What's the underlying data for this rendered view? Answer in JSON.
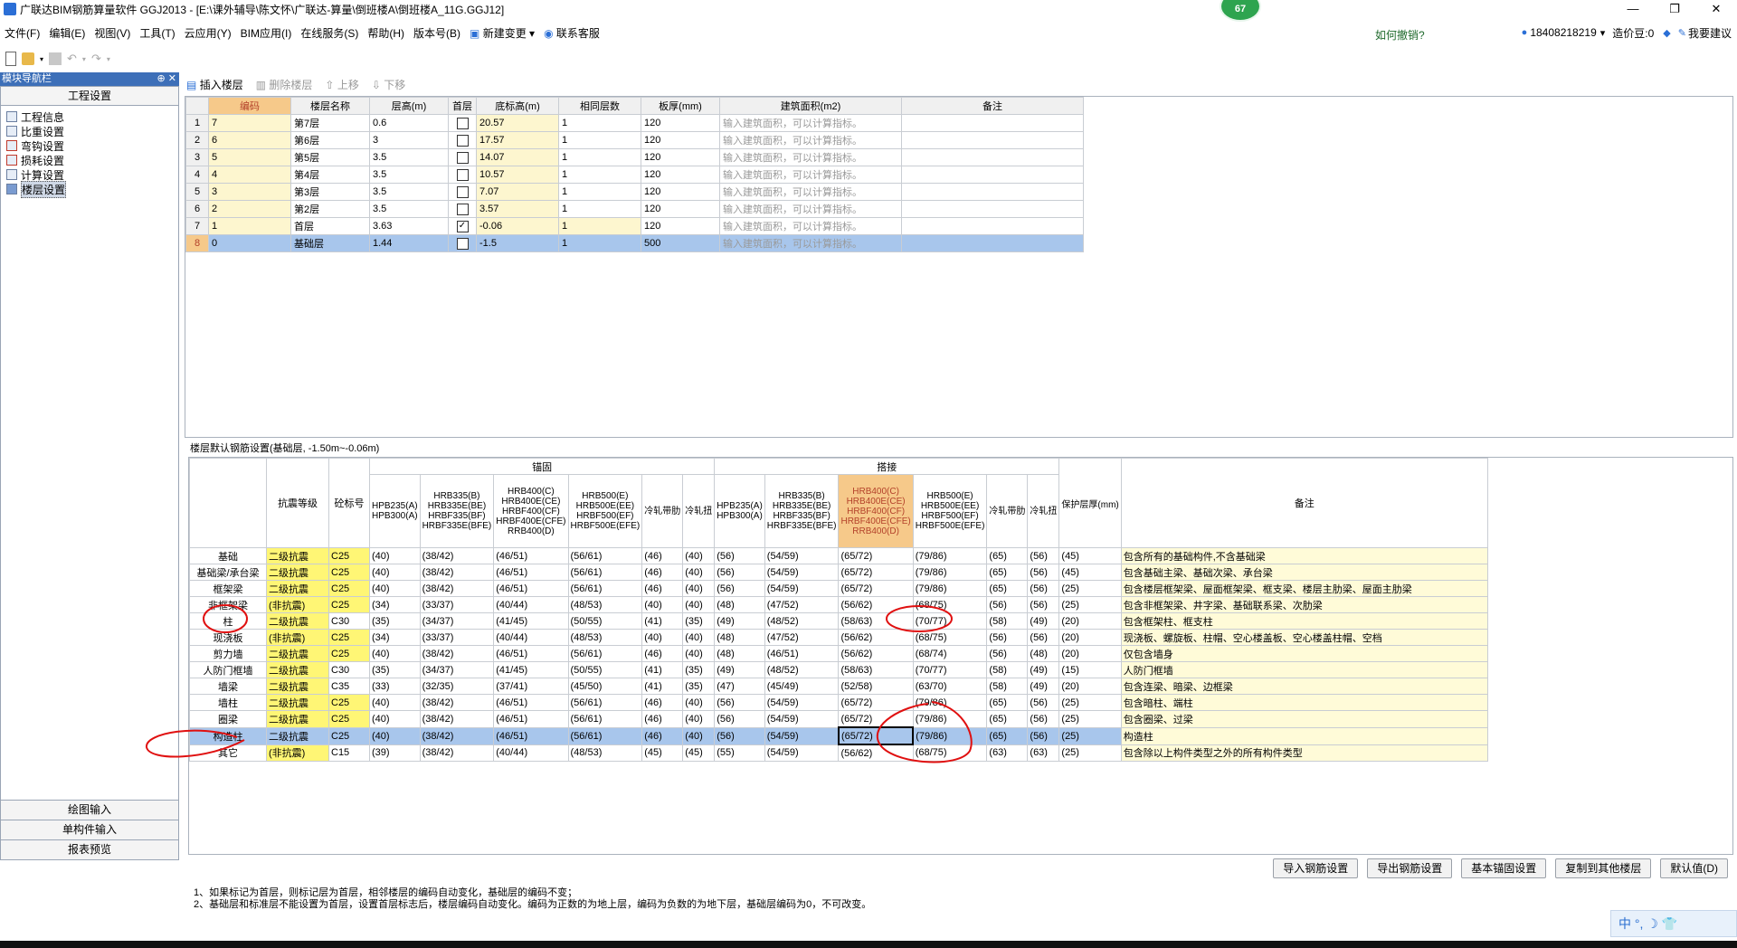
{
  "window": {
    "title": "广联达BIM钢筋算量软件 GGJ2013 - [E:\\课外辅导\\陈文怀\\广联达-算量\\倒班楼A\\倒班楼A_11G.GGJ12]",
    "badge": "67",
    "controls": [
      "—",
      "❐",
      "✕"
    ]
  },
  "menu": {
    "items": [
      "文件(F)",
      "编辑(E)",
      "视图(V)",
      "工具(T)",
      "云应用(Y)",
      "BIM应用(I)",
      "在线服务(S)",
      "帮助(H)",
      "版本号(B)",
      "新建变更",
      "联系客服"
    ],
    "help_text": "如何撤销?",
    "account": "18408218219",
    "beans": "造价豆:0",
    "want_help": "我要建议"
  },
  "nav": {
    "header": "模块导航栏",
    "pins": "⊕ ✕",
    "title": "工程设置",
    "items": [
      {
        "label": "工程信息",
        "icon": "info-icon"
      },
      {
        "label": "比重设置",
        "icon": "weight-icon"
      },
      {
        "label": "弯钩设置",
        "icon": "hook-icon"
      },
      {
        "label": "损耗设置",
        "icon": "loss-icon"
      },
      {
        "label": "计算设置",
        "icon": "calc-icon"
      },
      {
        "label": "楼层设置",
        "icon": "floor-icon"
      }
    ],
    "bottom": [
      "绘图输入",
      "单构件输入",
      "报表预览"
    ]
  },
  "floor_toolbar": {
    "insert": "插入楼层",
    "delete": "删除楼层",
    "up": "上移",
    "down": "下移"
  },
  "floor_table": {
    "headers": [
      "编码",
      "楼层名称",
      "层高(m)",
      "首层",
      "底标高(m)",
      "相同层数",
      "板厚(mm)",
      "建筑面积(m2)",
      "备注"
    ],
    "placeholder": "输入建筑面积，可以计算指标。",
    "rows": [
      {
        "n": "1",
        "code": "7",
        "name": "第7层",
        "h": "0.6",
        "first": false,
        "base": "20.57",
        "same": "1",
        "thick": "120"
      },
      {
        "n": "2",
        "code": "6",
        "name": "第6层",
        "h": "3",
        "first": false,
        "base": "17.57",
        "same": "1",
        "thick": "120"
      },
      {
        "n": "3",
        "code": "5",
        "name": "第5层",
        "h": "3.5",
        "first": false,
        "base": "14.07",
        "same": "1",
        "thick": "120"
      },
      {
        "n": "4",
        "code": "4",
        "name": "第4层",
        "h": "3.5",
        "first": false,
        "base": "10.57",
        "same": "1",
        "thick": "120"
      },
      {
        "n": "5",
        "code": "3",
        "name": "第3层",
        "h": "3.5",
        "first": false,
        "base": "7.07",
        "same": "1",
        "thick": "120"
      },
      {
        "n": "6",
        "code": "2",
        "name": "第2层",
        "h": "3.5",
        "first": false,
        "base": "3.57",
        "same": "1",
        "thick": "120"
      },
      {
        "n": "7",
        "code": "1",
        "name": "首层",
        "h": "3.63",
        "first": true,
        "base": "-0.06",
        "same": "1",
        "thick": "120"
      },
      {
        "n": "8",
        "code": "0",
        "name": "基础层",
        "h": "1.44",
        "first": false,
        "base": "-1.5",
        "same": "1",
        "thick": "500"
      }
    ]
  },
  "rebar": {
    "caption": "楼层默认钢筋设置(基础层, -1.50m~-0.06m)",
    "group_anchor": "锚固",
    "group_lap": "搭接",
    "h_grade": "抗震等级",
    "h_conc": "砼标号",
    "h_cover": "保护层厚(mm)",
    "h_note": "备注",
    "sub_headers": [
      "HPB235(A)\nHPB300(A)",
      "HRB335(B)\nHRB335E(BE)\nHRBF335(BF)\nHRBF335E(BFE)",
      "HRB400(C)\nHRB400E(CE)\nHRBF400(CF)\nHRBF400E(CFE)\nRRB400(D)",
      "HRB500(E)\nHRB500E(EE)\nHRBF500(EF)\nHRBF500E(EFE)",
      "冷轧带肋",
      "冷轧扭"
    ],
    "rows": [
      {
        "name": "基础",
        "grade": "二级抗震",
        "conc": "C25",
        "a": [
          "(40)",
          "(38/42)",
          "(46/51)",
          "(56/61)",
          "(46)",
          "(40)"
        ],
        "l": [
          "(56)",
          "(54/59)",
          "(65/72)",
          "(79/86)",
          "(65)",
          "(56)"
        ],
        "cover": "(45)",
        "note": "包含所有的基础构件,不含基础梁"
      },
      {
        "name": "基础梁/承台梁",
        "grade": "二级抗震",
        "conc": "C25",
        "a": [
          "(40)",
          "(38/42)",
          "(46/51)",
          "(56/61)",
          "(46)",
          "(40)"
        ],
        "l": [
          "(56)",
          "(54/59)",
          "(65/72)",
          "(79/86)",
          "(65)",
          "(56)"
        ],
        "cover": "(45)",
        "note": "包含基础主梁、基础次梁、承台梁"
      },
      {
        "name": "框架梁",
        "grade": "二级抗震",
        "conc": "C25",
        "a": [
          "(40)",
          "(38/42)",
          "(46/51)",
          "(56/61)",
          "(46)",
          "(40)"
        ],
        "l": [
          "(56)",
          "(54/59)",
          "(65/72)",
          "(79/86)",
          "(65)",
          "(56)"
        ],
        "cover": "(25)",
        "note": "包含楼层框架梁、屋面框架梁、框支梁、楼层主肋梁、屋面主肋梁"
      },
      {
        "name": "非框架梁",
        "grade": "(非抗震)",
        "conc": "C25",
        "a": [
          "(34)",
          "(33/37)",
          "(40/44)",
          "(48/53)",
          "(40)",
          "(40)"
        ],
        "l": [
          "(48)",
          "(47/52)",
          "(56/62)",
          "(68/75)",
          "(56)",
          "(56)"
        ],
        "cover": "(25)",
        "note": "包含非框架梁、井字梁、基础联系梁、次肋梁"
      },
      {
        "name": "柱",
        "grade": "二级抗震",
        "conc": "C30",
        "a": [
          "(35)",
          "(34/37)",
          "(41/45)",
          "(50/55)",
          "(41)",
          "(35)"
        ],
        "l": [
          "(49)",
          "(48/52)",
          "(58/63)",
          "(70/77)",
          "(58)",
          "(49)"
        ],
        "cover": "(20)",
        "note": "包含框架柱、框支柱"
      },
      {
        "name": "现浇板",
        "grade": "(非抗震)",
        "conc": "C25",
        "a": [
          "(34)",
          "(33/37)",
          "(40/44)",
          "(48/53)",
          "(40)",
          "(40)"
        ],
        "l": [
          "(48)",
          "(47/52)",
          "(56/62)",
          "(68/75)",
          "(56)",
          "(56)"
        ],
        "cover": "(20)",
        "note": "现浇板、螺旋板、柱帽、空心楼盖板、空心楼盖柱帽、空档"
      },
      {
        "name": "剪力墙",
        "grade": "二级抗震",
        "conc": "C25",
        "a": [
          "(40)",
          "(38/42)",
          "(46/51)",
          "(56/61)",
          "(46)",
          "(40)"
        ],
        "l": [
          "(48)",
          "(46/51)",
          "(56/62)",
          "(68/74)",
          "(56)",
          "(48)"
        ],
        "cover": "(20)",
        "note": "仅包含墙身"
      },
      {
        "name": "人防门框墙",
        "grade": "二级抗震",
        "conc": "C30",
        "a": [
          "(35)",
          "(34/37)",
          "(41/45)",
          "(50/55)",
          "(41)",
          "(35)"
        ],
        "l": [
          "(49)",
          "(48/52)",
          "(58/63)",
          "(70/77)",
          "(58)",
          "(49)"
        ],
        "cover": "(15)",
        "note": "人防门框墙"
      },
      {
        "name": "墙梁",
        "grade": "二级抗震",
        "conc": "C35",
        "a": [
          "(33)",
          "(32/35)",
          "(37/41)",
          "(45/50)",
          "(41)",
          "(35)"
        ],
        "l": [
          "(47)",
          "(45/49)",
          "(52/58)",
          "(63/70)",
          "(58)",
          "(49)"
        ],
        "cover": "(20)",
        "note": "包含连梁、暗梁、边框梁"
      },
      {
        "name": "墙柱",
        "grade": "二级抗震",
        "conc": "C25",
        "a": [
          "(40)",
          "(38/42)",
          "(46/51)",
          "(56/61)",
          "(46)",
          "(40)"
        ],
        "l": [
          "(56)",
          "(54/59)",
          "(65/72)",
          "(79/86)",
          "(65)",
          "(56)"
        ],
        "cover": "(25)",
        "note": "包含暗柱、端柱"
      },
      {
        "name": "圈梁",
        "grade": "二级抗震",
        "conc": "C25",
        "a": [
          "(40)",
          "(38/42)",
          "(46/51)",
          "(56/61)",
          "(46)",
          "(40)"
        ],
        "l": [
          "(56)",
          "(54/59)",
          "(65/72)",
          "(79/86)",
          "(65)",
          "(56)"
        ],
        "cover": "(25)",
        "note": "包含圈梁、过梁"
      },
      {
        "name": "构造柱",
        "grade": "二级抗震",
        "conc": "C25",
        "a": [
          "(40)",
          "(38/42)",
          "(46/51)",
          "(56/61)",
          "(46)",
          "(40)"
        ],
        "l": [
          "(56)",
          "(54/59)",
          "(65/72)",
          "(79/86)",
          "(65)",
          "(56)"
        ],
        "cover": "(25)",
        "note": "构造柱"
      },
      {
        "name": "其它",
        "grade": "(非抗震)",
        "conc": "C15",
        "a": [
          "(39)",
          "(38/42)",
          "(40/44)",
          "(48/53)",
          "(45)",
          "(45)"
        ],
        "l": [
          "(55)",
          "(54/59)",
          "(56/62)",
          "(68/75)",
          "(63)",
          "(63)"
        ],
        "cover": "(25)",
        "note": "包含除以上构件类型之外的所有构件类型"
      }
    ]
  },
  "buttons": [
    "导入钢筋设置",
    "导出钢筋设置",
    "基本锚固设置",
    "复制到其他楼层",
    "默认值(D)"
  ],
  "notes": [
    "1、如果标记为首层，则标记层为首层，相邻楼层的编码自动变化，基础层的编码不变；",
    "2、基础层和标准层不能设置为首层，设置首层标志后，楼层编码自动变化。编码为正数的为地上层，编码为负数的为地下层，基础层编码为0，不可改变。"
  ],
  "ime": "中 °, ☽ 👕"
}
